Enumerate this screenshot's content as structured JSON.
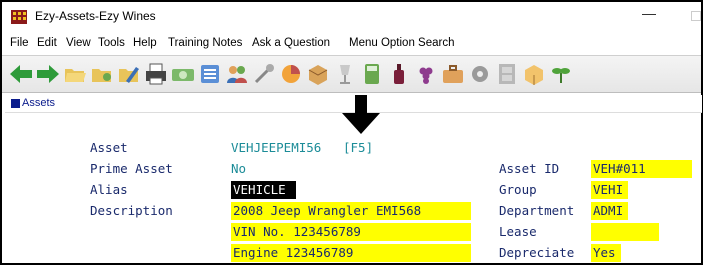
{
  "window": {
    "title": "Ezy-Assets-Ezy Wines",
    "minimize_glyph": "—"
  },
  "menu": [
    "File",
    "Edit",
    "View",
    "Tools",
    "Help",
    "Training Notes",
    "Ask a Question",
    "Menu Option Search"
  ],
  "toolbar_icons": [
    "back-arrow-icon",
    "forward-arrow-icon",
    "folder-open-icon",
    "folder-tools-icon",
    "folder-edit-icon",
    "printer-icon",
    "money-icon",
    "list-icon",
    "users-icon",
    "wrench-icon",
    "pie-chart-icon",
    "box-icon",
    "glass-icon",
    "calculator-icon",
    "wine-bottle-icon",
    "grapes-icon",
    "briefcase-icon",
    "gear-icon",
    "cabinet-icon",
    "package-icon",
    "plant-icon"
  ],
  "panel": {
    "title": "Assets"
  },
  "form": {
    "asset_label": "Asset",
    "asset_value": "VEHJEEPEMI56",
    "asset_hotkey": "[F5]",
    "prime_label": "Prime Asset",
    "prime_value": "No",
    "alias_label": "Alias",
    "alias_value": "VEHICLE",
    "desc_label": "Description",
    "desc_line1": "2008 Jeep Wrangler EMI568",
    "desc_line2": "VIN No. 123456789",
    "desc_line3": "Engine  123456789",
    "asset_id_label": "Asset ID",
    "asset_id_value": "VEH#011",
    "group_label": "Group",
    "group_value": "VEHI",
    "dept_label": "Department",
    "dept_value": "ADMI",
    "lease_label": "Lease",
    "lease_value": "",
    "depr_label": "Depreciate",
    "depr_value": "Yes"
  },
  "colors": {
    "label": "#1a2a6c",
    "teal": "#1c8c98",
    "highlight": "#ffff00",
    "panel_title": "#0a1b8c"
  }
}
